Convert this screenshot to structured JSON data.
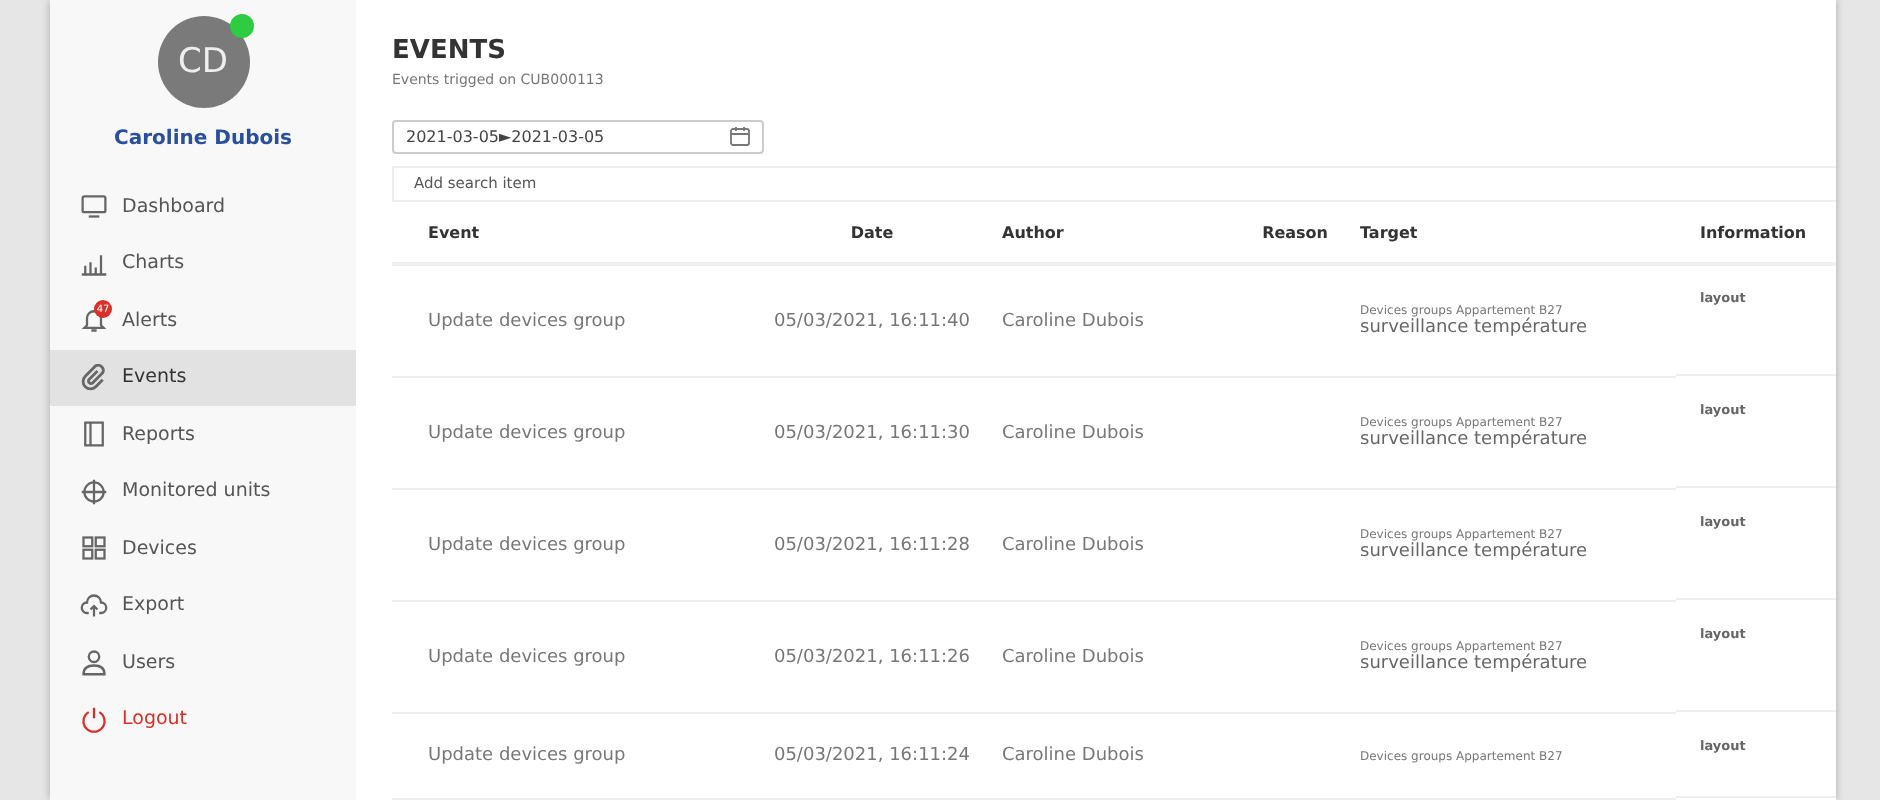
{
  "user": {
    "initials": "CD",
    "name": "Caroline Dubois",
    "online": true
  },
  "sidebar": {
    "items": [
      {
        "label": "Dashboard",
        "selected": false,
        "kind": "normal"
      },
      {
        "label": "Charts",
        "selected": false,
        "kind": "normal"
      },
      {
        "label": "Alerts",
        "selected": false,
        "kind": "normal",
        "badge": "47"
      },
      {
        "label": "Events",
        "selected": true,
        "kind": "normal"
      },
      {
        "label": "Reports",
        "selected": false,
        "kind": "normal"
      },
      {
        "label": "Monitored units",
        "selected": false,
        "kind": "normal"
      },
      {
        "label": "Devices",
        "selected": false,
        "kind": "normal"
      },
      {
        "label": "Export",
        "selected": false,
        "kind": "normal"
      },
      {
        "label": "Users",
        "selected": false,
        "kind": "normal"
      },
      {
        "label": "Logout",
        "selected": false,
        "kind": "danger"
      }
    ]
  },
  "page": {
    "title": "EVENTS",
    "subtitle": "Events trigged on CUB000113"
  },
  "date_range": {
    "value": "2021-03-05►2021-03-05"
  },
  "search": {
    "placeholder": "Add search item"
  },
  "table": {
    "columns": [
      "Event",
      "Date",
      "Author",
      "Reason",
      "Target",
      "Information"
    ],
    "rows": [
      {
        "event": "Update devices group",
        "date": "05/03/2021, 16:11:40",
        "author": "Caroline Dubois",
        "target_type": "Devices groups Appartement B27",
        "target_name": "surveillance température",
        "information": "layout"
      },
      {
        "event": "Update devices group",
        "date": "05/03/2021, 16:11:30",
        "author": "Caroline Dubois",
        "target_type": "Devices groups Appartement B27",
        "target_name": "surveillance température",
        "information": "layout"
      },
      {
        "event": "Update devices group",
        "date": "05/03/2021, 16:11:28",
        "author": "Caroline Dubois",
        "target_type": "Devices groups Appartement B27",
        "target_name": "surveillance température",
        "information": "layout"
      },
      {
        "event": "Update devices group",
        "date": "05/03/2021, 16:11:26",
        "author": "Caroline Dubois",
        "target_type": "Devices groups Appartement B27",
        "target_name": "surveillance température",
        "information": "layout"
      },
      {
        "event": "Update devices group",
        "date": "05/03/2021, 16:11:24",
        "author": "Caroline Dubois",
        "target_type": "Devices groups Appartement B27",
        "information": "layout"
      }
    ]
  }
}
